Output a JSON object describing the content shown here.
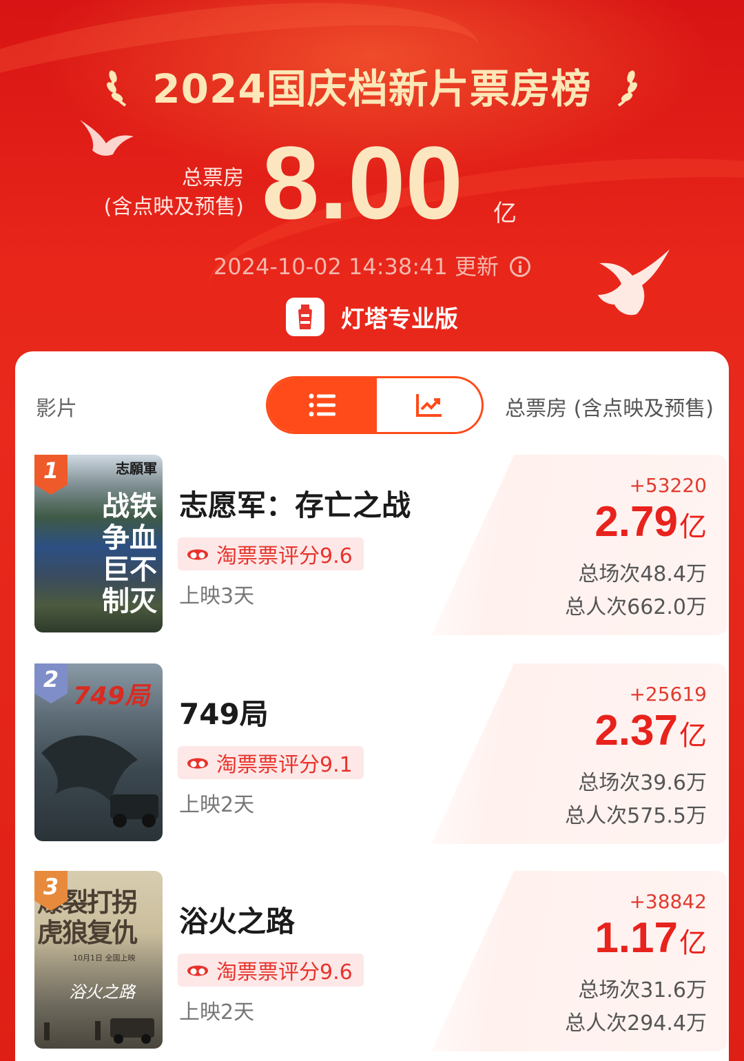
{
  "header": {
    "title": "2024国庆档新片票房榜",
    "total_label_line1": "总票房",
    "total_label_line2": "(含点映及预售)",
    "total_value": "8.00",
    "total_unit": "亿",
    "updated_time": "2024-10-02 14:38:41",
    "updated_suffix": "更新",
    "brand": "灯塔专业版"
  },
  "list_header": {
    "film_col": "影片",
    "total_col": "总票房 (含点映及预售)",
    "view_toggle": [
      "list-icon",
      "trend-chart-icon"
    ]
  },
  "films": [
    {
      "rank": "1",
      "title": "志愿军：存亡之战",
      "rating": "淘票票评分9.6",
      "days": "上映3天",
      "increment": "+53220",
      "gross": "2.79",
      "gross_unit": "亿",
      "screenings": "总场次48.4万",
      "admissions": "总人次662.0万",
      "poster_text": [
        "志願軍",
        "战铁",
        "争血",
        "巨不",
        "制灭"
      ]
    },
    {
      "rank": "2",
      "title": "749局",
      "rating": "淘票票评分9.1",
      "days": "上映2天",
      "increment": "+25619",
      "gross": "2.37",
      "gross_unit": "亿",
      "screenings": "总场次39.6万",
      "admissions": "总人次575.5万",
      "poster_text": [
        "749局"
      ]
    },
    {
      "rank": "3",
      "title": "浴火之路",
      "rating": "淘票票评分9.6",
      "days": "上映2天",
      "increment": "+38842",
      "gross": "1.17",
      "gross_unit": "亿",
      "screenings": "总场次31.6万",
      "admissions": "总人次294.4万",
      "poster_text": [
        "爆裂打拐",
        "虎狼复仇",
        "10月1日 全国上映",
        "浴火之路"
      ]
    }
  ],
  "colors": {
    "bg_red": "#e8261a",
    "gold": "#fbe6c0",
    "accent_orange": "#ff4b1a",
    "gross_red": "#e8221c",
    "rank1": "#ef5a2a",
    "rank2": "#7f8ec8",
    "rank3": "#e78a3c"
  }
}
